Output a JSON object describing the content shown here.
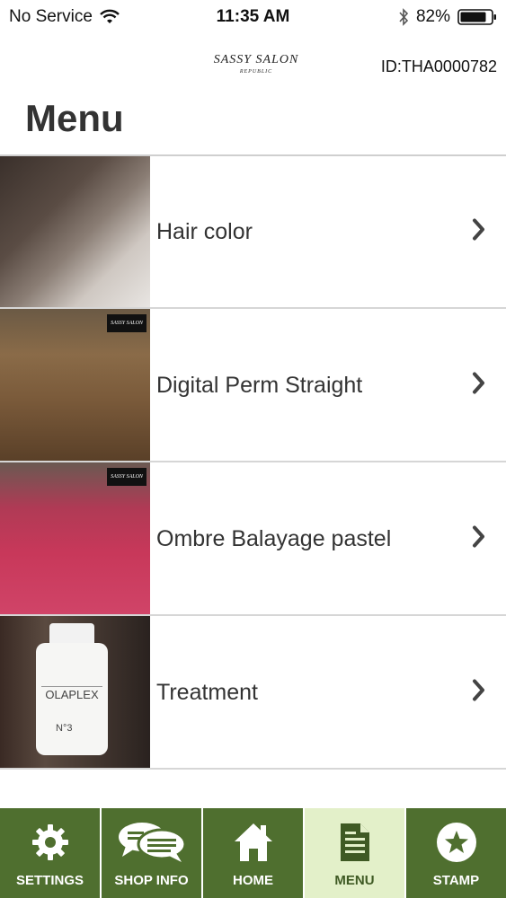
{
  "status_bar": {
    "carrier": "No Service",
    "time": "11:35 AM",
    "battery": "82%"
  },
  "header": {
    "logo_main": "SASSY SALON",
    "logo_sub": "REPUBLIC",
    "member_id": "ID:THA0000782"
  },
  "page": {
    "title": "Menu"
  },
  "menu": {
    "items": [
      {
        "label": "Hair color"
      },
      {
        "label": "Digital Perm Straight"
      },
      {
        "label": "Ombre Balayage pastel"
      },
      {
        "label": "Treatment"
      }
    ]
  },
  "tabs": [
    {
      "label": "SETTINGS",
      "icon": "gear-icon"
    },
    {
      "label": "SHOP INFO",
      "icon": "chat-bubbles-icon"
    },
    {
      "label": "HOME",
      "icon": "home-icon"
    },
    {
      "label": "MENU",
      "icon": "document-icon",
      "active": true
    },
    {
      "label": "STAMP",
      "icon": "star-icon"
    }
  ],
  "colors": {
    "tab_bar": "#4f6f2f",
    "tab_active": "#e3f0c9"
  }
}
